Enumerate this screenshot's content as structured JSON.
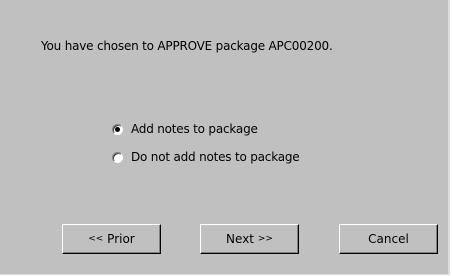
{
  "message": "You have chosen to APPROVE package APC00200.",
  "options": [
    {
      "label": "Add notes to package",
      "selected": true
    },
    {
      "label": "Do not add notes to package",
      "selected": false
    }
  ],
  "buttons": {
    "prior_arrow": "<<",
    "prior_label": "Prior",
    "next_label": "Next",
    "next_arrow": ">>",
    "cancel_label": "Cancel"
  }
}
